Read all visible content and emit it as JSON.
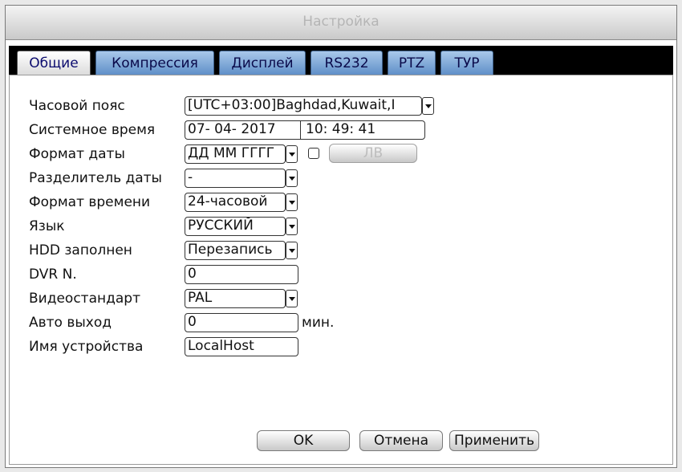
{
  "window": {
    "title": "Настройка"
  },
  "tabs": [
    {
      "label": "Общие",
      "active": true
    },
    {
      "label": "Компрессия",
      "active": false
    },
    {
      "label": "Дисплей",
      "active": false
    },
    {
      "label": "RS232",
      "active": false
    },
    {
      "label": "PTZ",
      "active": false
    },
    {
      "label": "ТУР",
      "active": false
    }
  ],
  "settings": {
    "timezone": {
      "label": "Часовой пояс",
      "value": "[UTC+03:00]Baghdad,Kuwait,I"
    },
    "system_time": {
      "label": "Системное время",
      "date": "07- 04- 2017",
      "time": "10: 49: 41"
    },
    "date_format": {
      "label": "Формат даты",
      "value": "ДД ММ ГГГГ",
      "dst_button": "ЛВ"
    },
    "date_separator": {
      "label": "Разделитель даты",
      "value": "-"
    },
    "time_format": {
      "label": "Формат времени",
      "value": "24-часовой"
    },
    "language": {
      "label": "Язык",
      "value": "РУССКИЙ"
    },
    "hdd_full": {
      "label": "HDD заполнен",
      "value": "Перезапись"
    },
    "dvr_no": {
      "label": "DVR N.",
      "value": "0"
    },
    "video_standard": {
      "label": "Видеостандарт",
      "value": "PAL"
    },
    "auto_logout": {
      "label": "Авто выход",
      "value": "0",
      "unit": "мин."
    },
    "device_name": {
      "label": "Имя устройства",
      "value": "LocalHost"
    }
  },
  "buttons": {
    "ok": "OK",
    "cancel": "Отмена",
    "apply": "Применить"
  },
  "colors": {
    "tab_active_text": "#0b0b6e",
    "tab_bg": "#5f8fc8",
    "tabbar_bg": "#000000"
  }
}
